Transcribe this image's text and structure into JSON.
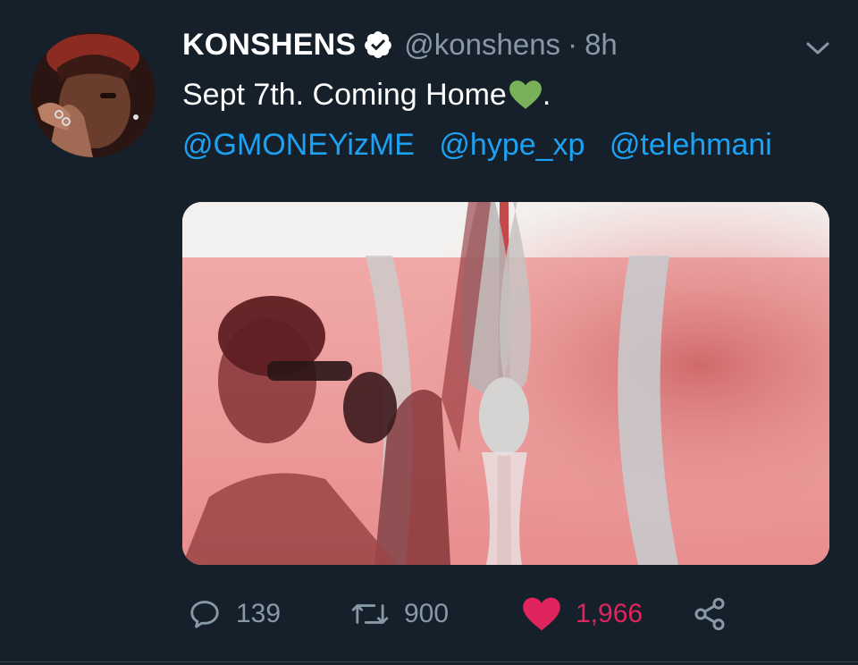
{
  "tweet": {
    "author": {
      "display_name": "KONSHENS",
      "handle": "@konshens",
      "verified": true,
      "avatar": "profile-photo"
    },
    "separator": "·",
    "time": "8h",
    "text": "Sept 7th.  Coming Home",
    "text_suffix": ".",
    "emoji": "green-heart",
    "mentions": [
      "@GMONEYizME",
      "@hype_xp",
      "@telehmani"
    ],
    "media": {
      "description_icon": "kenyan-flag-photo"
    },
    "stats": {
      "replies": "139",
      "retweets": "900",
      "likes": "1,966"
    },
    "colors": {
      "background": "#15202b",
      "link": "#1da1f2",
      "muted": "#8899a6",
      "like": "#e0245e",
      "emoji_green": "#78b159"
    }
  }
}
